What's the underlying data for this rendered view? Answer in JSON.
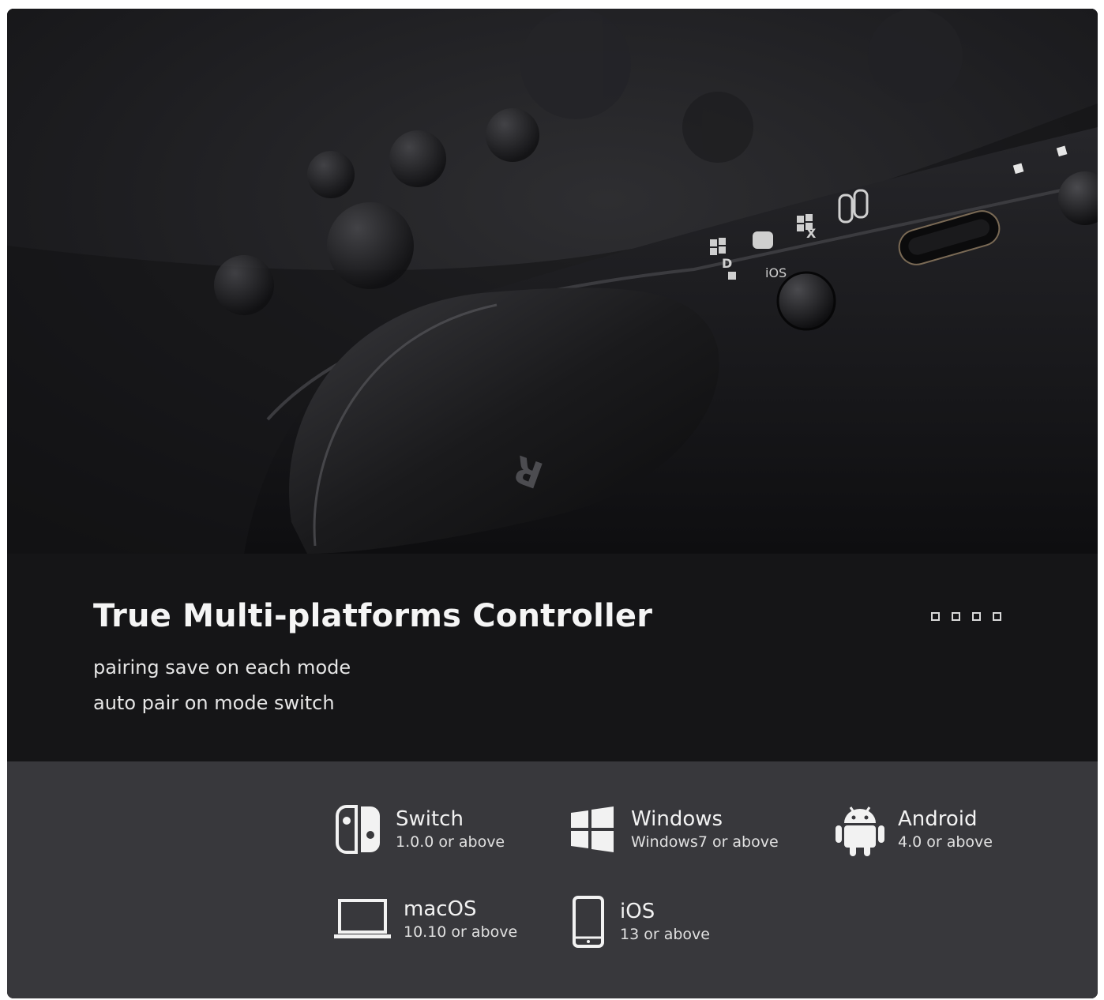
{
  "photo": {
    "panel_labels": [
      "D",
      "iOS",
      "X"
    ],
    "trigger_letter": "R"
  },
  "hero": {
    "title": "True Multi-platforms Controller",
    "lines": [
      "pairing save on each mode",
      "auto pair on mode switch"
    ],
    "slide_indicator_count": 4
  },
  "platforms": [
    {
      "icon": "switch-icon",
      "name": "Switch",
      "version": "1.0.0 or above"
    },
    {
      "icon": "windows-icon",
      "name": "Windows",
      "version": "Windows7 or above"
    },
    {
      "icon": "android-icon",
      "name": "Android",
      "version": "4.0 or above"
    },
    {
      "icon": "laptop-icon",
      "name": "macOS",
      "version": "10.10 or above"
    },
    {
      "icon": "phone-icon",
      "name": "iOS",
      "version": "13 or above"
    }
  ],
  "colors": {
    "hero_bg": "#151517",
    "platforms_bg": "#38383c",
    "text": "#f2f2f2"
  }
}
